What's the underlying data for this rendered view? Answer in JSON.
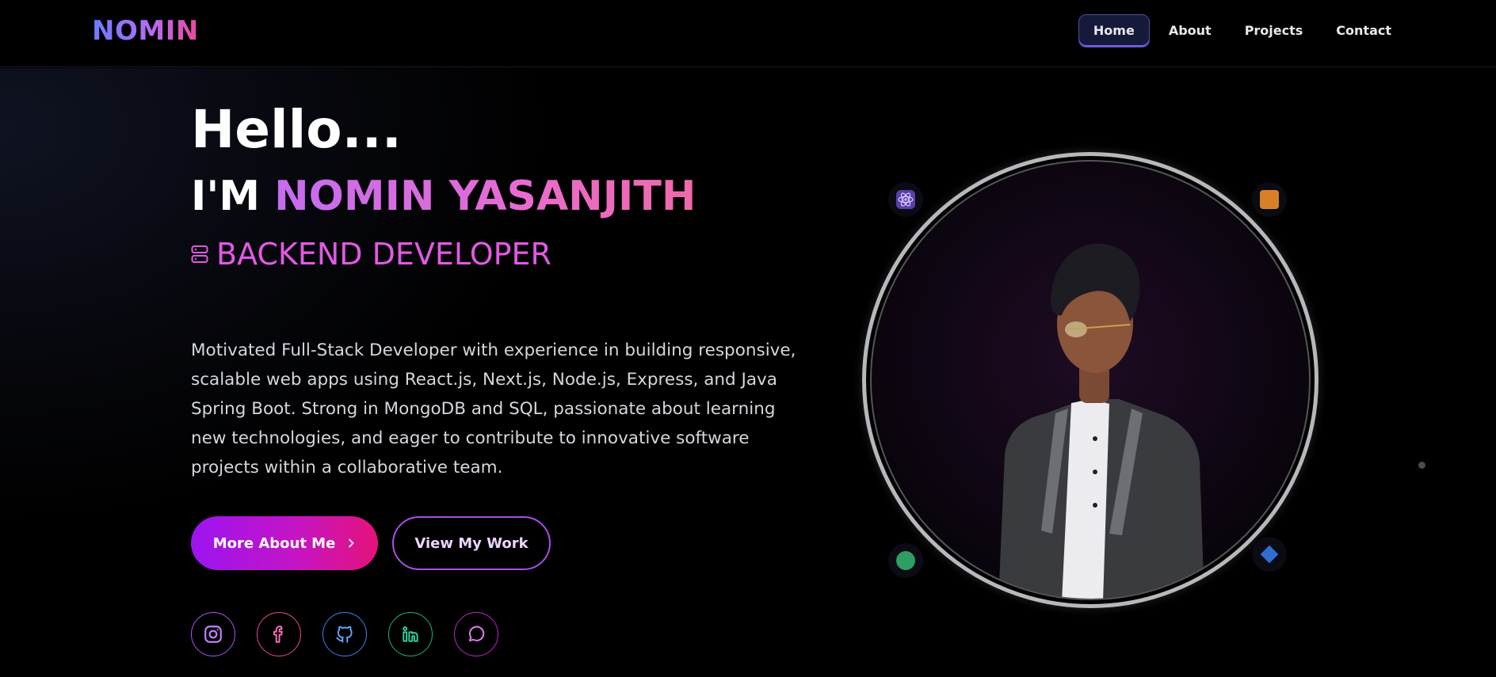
{
  "brand": {
    "logo": "NOMIN"
  },
  "nav": {
    "items": [
      {
        "label": "Home",
        "active": true
      },
      {
        "label": "About",
        "active": false
      },
      {
        "label": "Projects",
        "active": false
      },
      {
        "label": "Contact",
        "active": false
      }
    ]
  },
  "hero": {
    "greeting": "Hello...",
    "intro_prefix": "I'M",
    "name": "NOMIN YASANJITH",
    "role": "BACKEND DEVELOPER",
    "role_icon": "server-icon",
    "bio": "Motivated Full-Stack Developer with experience in building responsive, scalable web apps using React.js, Next.js, Node.js, Express, and Java Spring Boot. Strong in MongoDB and SQL, passionate about learning new technologies, and eager to contribute to innovative software projects within a collaborative team.",
    "primary_button": "More About Me",
    "secondary_button": "View My Work"
  },
  "socials": [
    {
      "icon": "instagram-icon",
      "color": "#a855f7"
    },
    {
      "icon": "facebook-icon",
      "color": "#ec4899"
    },
    {
      "icon": "github-icon",
      "color": "#3b82f6"
    },
    {
      "icon": "linkedin-icon",
      "color": "#10b981"
    },
    {
      "icon": "chat-icon",
      "color": "#c026d3"
    }
  ],
  "portrait": {
    "badges": [
      "react-icon",
      "orange-square-icon",
      "green-circle-icon",
      "blue-diamond-icon"
    ]
  },
  "colors": {
    "accent_purple": "#9b15f0",
    "accent_pink": "#e5137a",
    "name_gradient_start": "#c46cf0",
    "name_gradient_end": "#ef6aa8",
    "role_color": "#e259e4"
  }
}
